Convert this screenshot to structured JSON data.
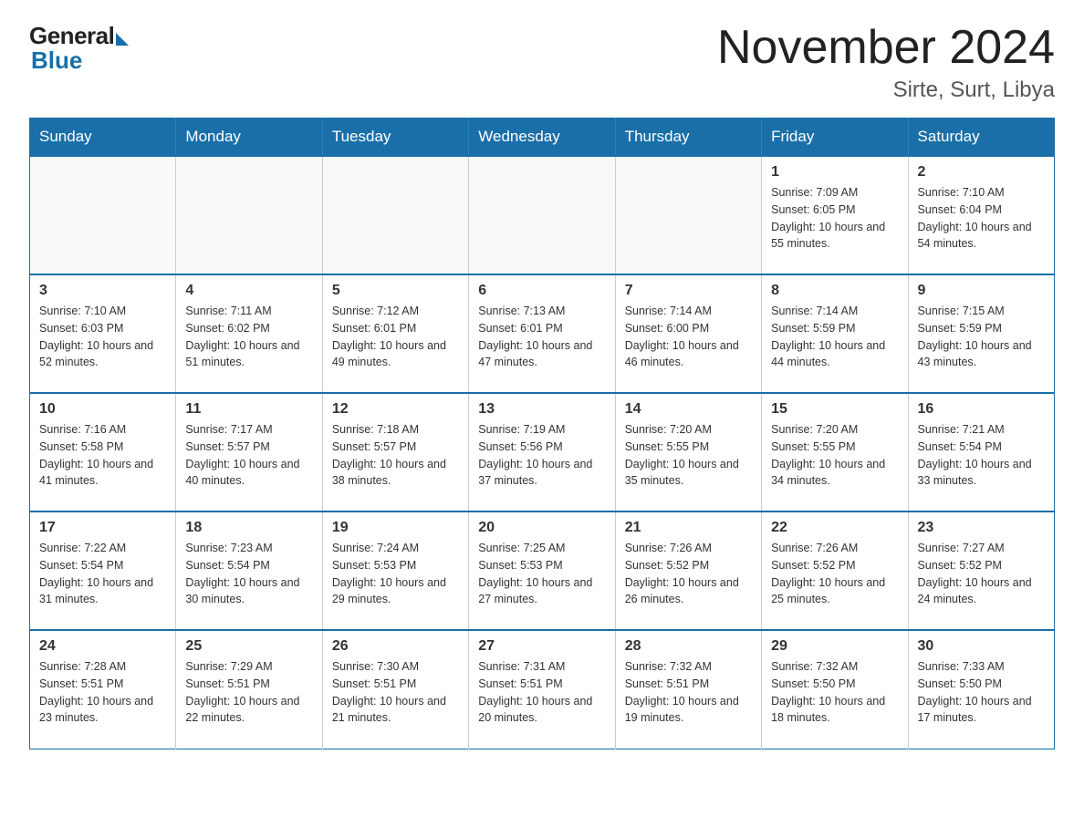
{
  "logo": {
    "general": "General",
    "blue": "Blue"
  },
  "title": "November 2024",
  "location": "Sirte, Surt, Libya",
  "days_of_week": [
    "Sunday",
    "Monday",
    "Tuesday",
    "Wednesday",
    "Thursday",
    "Friday",
    "Saturday"
  ],
  "weeks": [
    [
      {
        "day": "",
        "info": ""
      },
      {
        "day": "",
        "info": ""
      },
      {
        "day": "",
        "info": ""
      },
      {
        "day": "",
        "info": ""
      },
      {
        "day": "",
        "info": ""
      },
      {
        "day": "1",
        "info": "Sunrise: 7:09 AM\nSunset: 6:05 PM\nDaylight: 10 hours and 55 minutes."
      },
      {
        "day": "2",
        "info": "Sunrise: 7:10 AM\nSunset: 6:04 PM\nDaylight: 10 hours and 54 minutes."
      }
    ],
    [
      {
        "day": "3",
        "info": "Sunrise: 7:10 AM\nSunset: 6:03 PM\nDaylight: 10 hours and 52 minutes."
      },
      {
        "day": "4",
        "info": "Sunrise: 7:11 AM\nSunset: 6:02 PM\nDaylight: 10 hours and 51 minutes."
      },
      {
        "day": "5",
        "info": "Sunrise: 7:12 AM\nSunset: 6:01 PM\nDaylight: 10 hours and 49 minutes."
      },
      {
        "day": "6",
        "info": "Sunrise: 7:13 AM\nSunset: 6:01 PM\nDaylight: 10 hours and 47 minutes."
      },
      {
        "day": "7",
        "info": "Sunrise: 7:14 AM\nSunset: 6:00 PM\nDaylight: 10 hours and 46 minutes."
      },
      {
        "day": "8",
        "info": "Sunrise: 7:14 AM\nSunset: 5:59 PM\nDaylight: 10 hours and 44 minutes."
      },
      {
        "day": "9",
        "info": "Sunrise: 7:15 AM\nSunset: 5:59 PM\nDaylight: 10 hours and 43 minutes."
      }
    ],
    [
      {
        "day": "10",
        "info": "Sunrise: 7:16 AM\nSunset: 5:58 PM\nDaylight: 10 hours and 41 minutes."
      },
      {
        "day": "11",
        "info": "Sunrise: 7:17 AM\nSunset: 5:57 PM\nDaylight: 10 hours and 40 minutes."
      },
      {
        "day": "12",
        "info": "Sunrise: 7:18 AM\nSunset: 5:57 PM\nDaylight: 10 hours and 38 minutes."
      },
      {
        "day": "13",
        "info": "Sunrise: 7:19 AM\nSunset: 5:56 PM\nDaylight: 10 hours and 37 minutes."
      },
      {
        "day": "14",
        "info": "Sunrise: 7:20 AM\nSunset: 5:55 PM\nDaylight: 10 hours and 35 minutes."
      },
      {
        "day": "15",
        "info": "Sunrise: 7:20 AM\nSunset: 5:55 PM\nDaylight: 10 hours and 34 minutes."
      },
      {
        "day": "16",
        "info": "Sunrise: 7:21 AM\nSunset: 5:54 PM\nDaylight: 10 hours and 33 minutes."
      }
    ],
    [
      {
        "day": "17",
        "info": "Sunrise: 7:22 AM\nSunset: 5:54 PM\nDaylight: 10 hours and 31 minutes."
      },
      {
        "day": "18",
        "info": "Sunrise: 7:23 AM\nSunset: 5:54 PM\nDaylight: 10 hours and 30 minutes."
      },
      {
        "day": "19",
        "info": "Sunrise: 7:24 AM\nSunset: 5:53 PM\nDaylight: 10 hours and 29 minutes."
      },
      {
        "day": "20",
        "info": "Sunrise: 7:25 AM\nSunset: 5:53 PM\nDaylight: 10 hours and 27 minutes."
      },
      {
        "day": "21",
        "info": "Sunrise: 7:26 AM\nSunset: 5:52 PM\nDaylight: 10 hours and 26 minutes."
      },
      {
        "day": "22",
        "info": "Sunrise: 7:26 AM\nSunset: 5:52 PM\nDaylight: 10 hours and 25 minutes."
      },
      {
        "day": "23",
        "info": "Sunrise: 7:27 AM\nSunset: 5:52 PM\nDaylight: 10 hours and 24 minutes."
      }
    ],
    [
      {
        "day": "24",
        "info": "Sunrise: 7:28 AM\nSunset: 5:51 PM\nDaylight: 10 hours and 23 minutes."
      },
      {
        "day": "25",
        "info": "Sunrise: 7:29 AM\nSunset: 5:51 PM\nDaylight: 10 hours and 22 minutes."
      },
      {
        "day": "26",
        "info": "Sunrise: 7:30 AM\nSunset: 5:51 PM\nDaylight: 10 hours and 21 minutes."
      },
      {
        "day": "27",
        "info": "Sunrise: 7:31 AM\nSunset: 5:51 PM\nDaylight: 10 hours and 20 minutes."
      },
      {
        "day": "28",
        "info": "Sunrise: 7:32 AM\nSunset: 5:51 PM\nDaylight: 10 hours and 19 minutes."
      },
      {
        "day": "29",
        "info": "Sunrise: 7:32 AM\nSunset: 5:50 PM\nDaylight: 10 hours and 18 minutes."
      },
      {
        "day": "30",
        "info": "Sunrise: 7:33 AM\nSunset: 5:50 PM\nDaylight: 10 hours and 17 minutes."
      }
    ]
  ]
}
